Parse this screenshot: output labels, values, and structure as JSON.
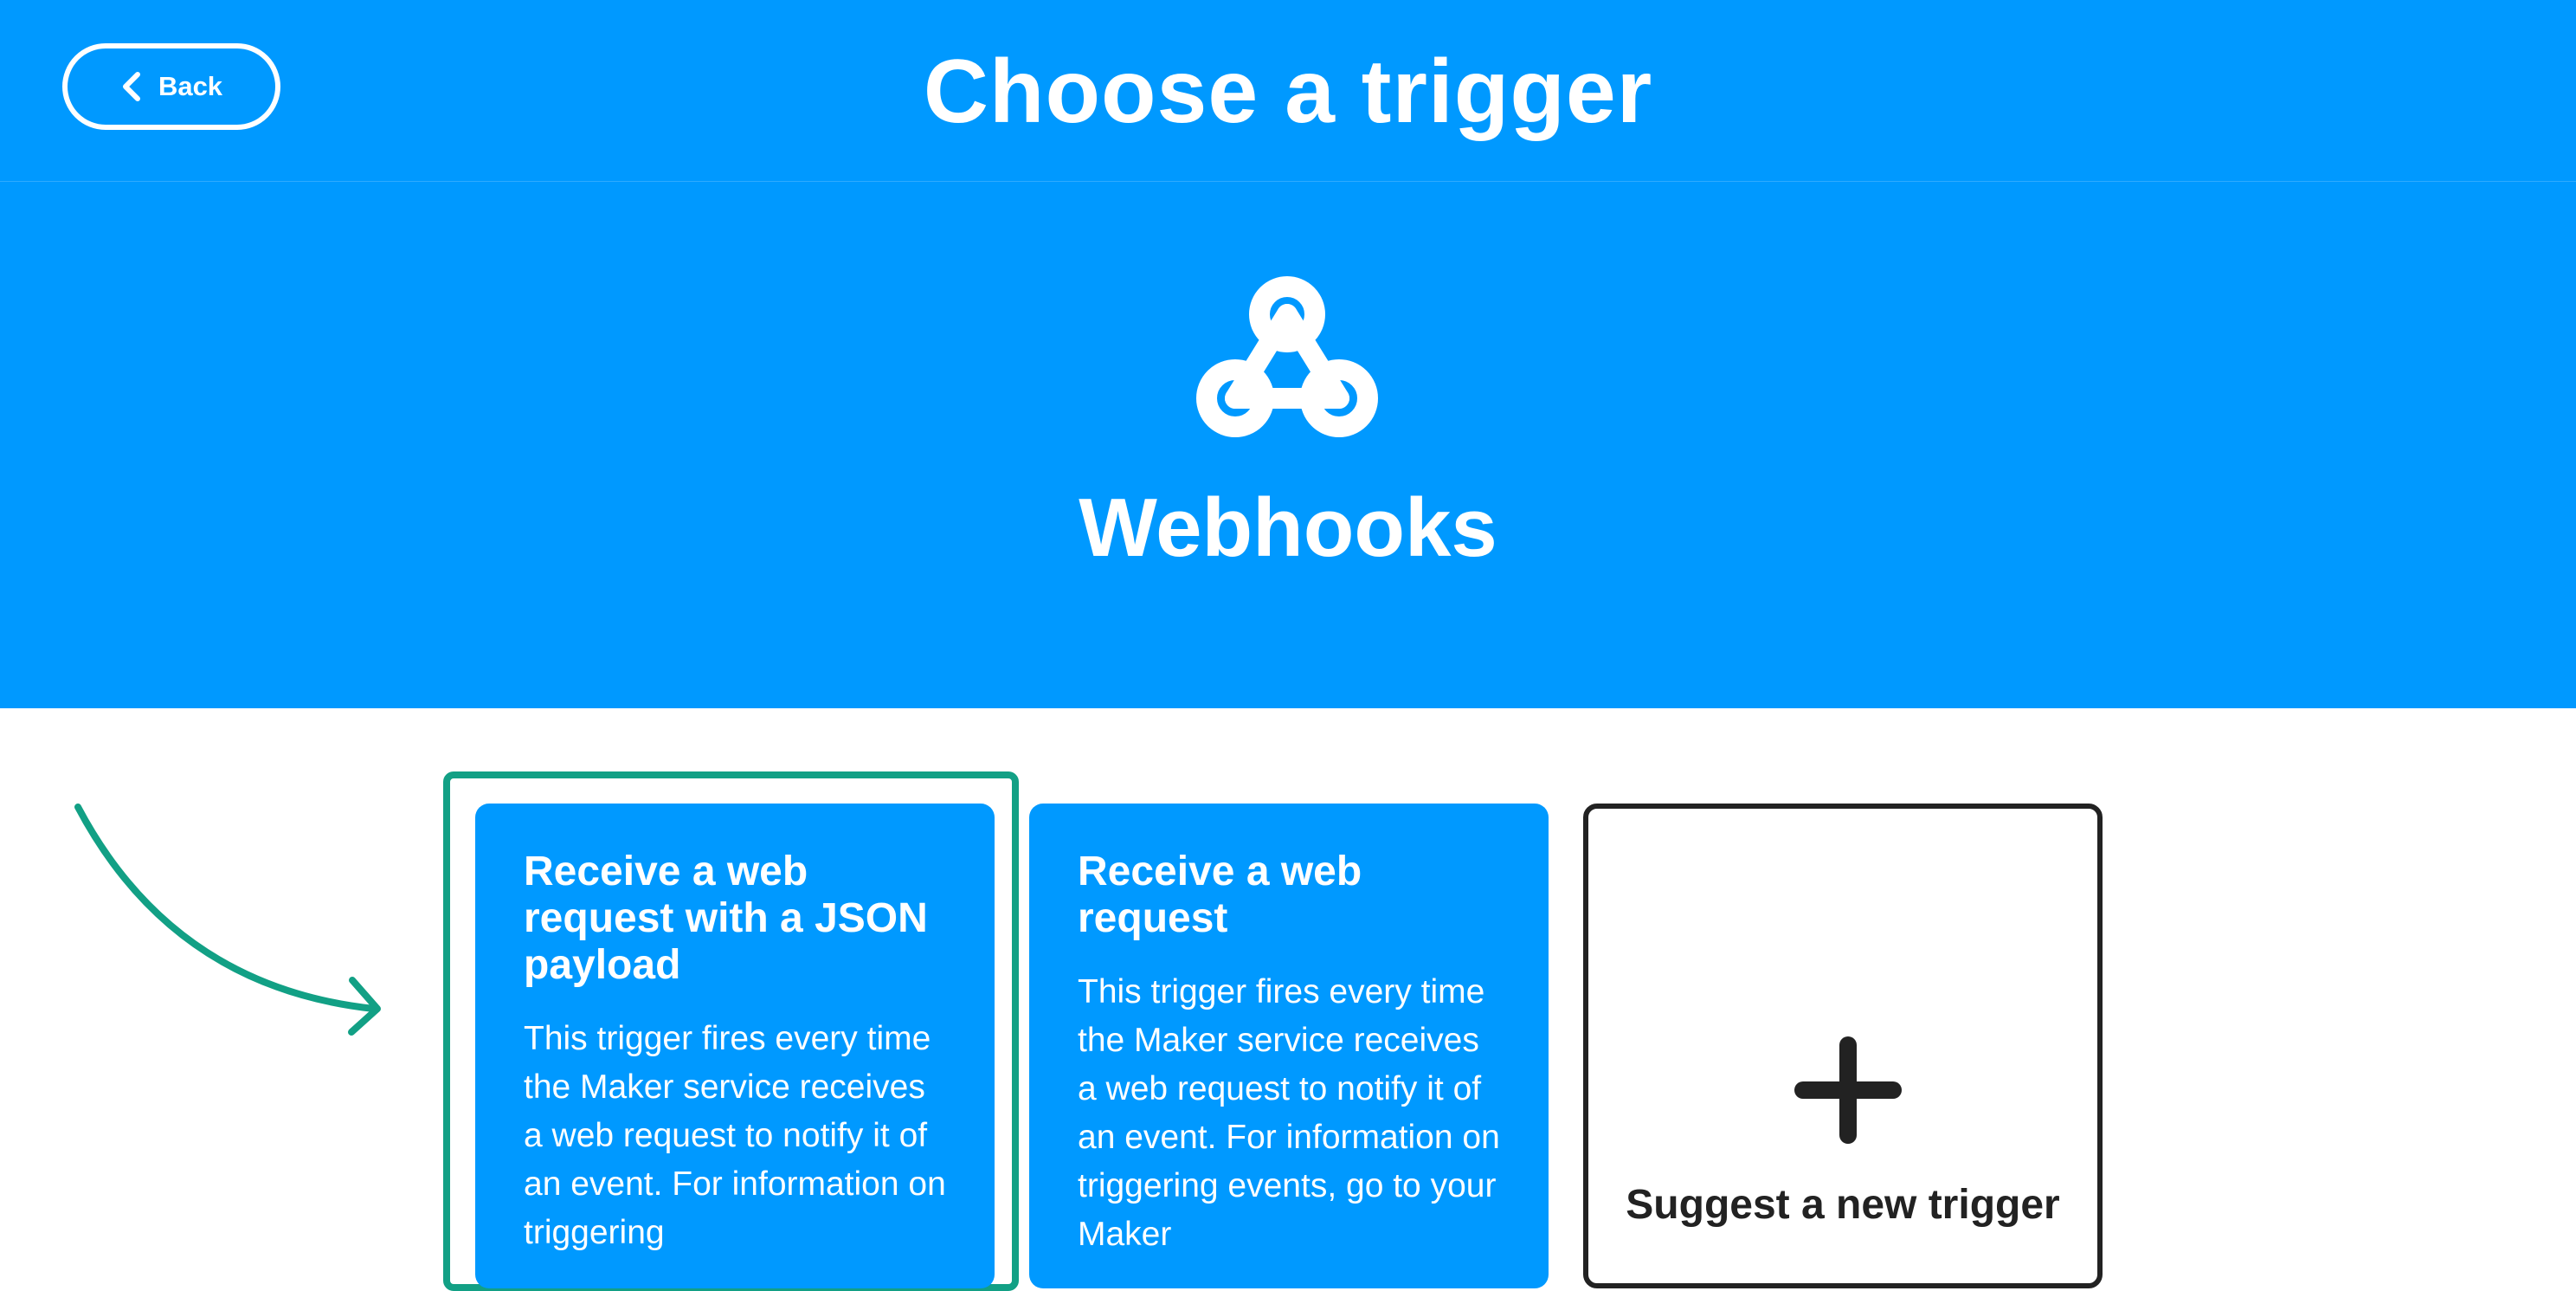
{
  "header": {
    "back_label": "Back",
    "title": "Choose a trigger"
  },
  "service": {
    "icon": "webhooks-icon",
    "name": "Webhooks"
  },
  "triggers": [
    {
      "title": "Receive a web request with a JSON payload",
      "description": "This trigger fires every time the Maker service receives a web request to notify it of an event. For information on triggering"
    },
    {
      "title": "Receive a web request",
      "description": "This trigger fires every time the Maker service receives a web request to notify it of an event. For information on triggering events, go to your Maker"
    }
  ],
  "suggest": {
    "label": "Suggest a new trigger"
  },
  "colors": {
    "brand_blue": "#0099ff",
    "highlight_green": "#12a085",
    "dark": "#222222",
    "white": "#ffffff"
  }
}
